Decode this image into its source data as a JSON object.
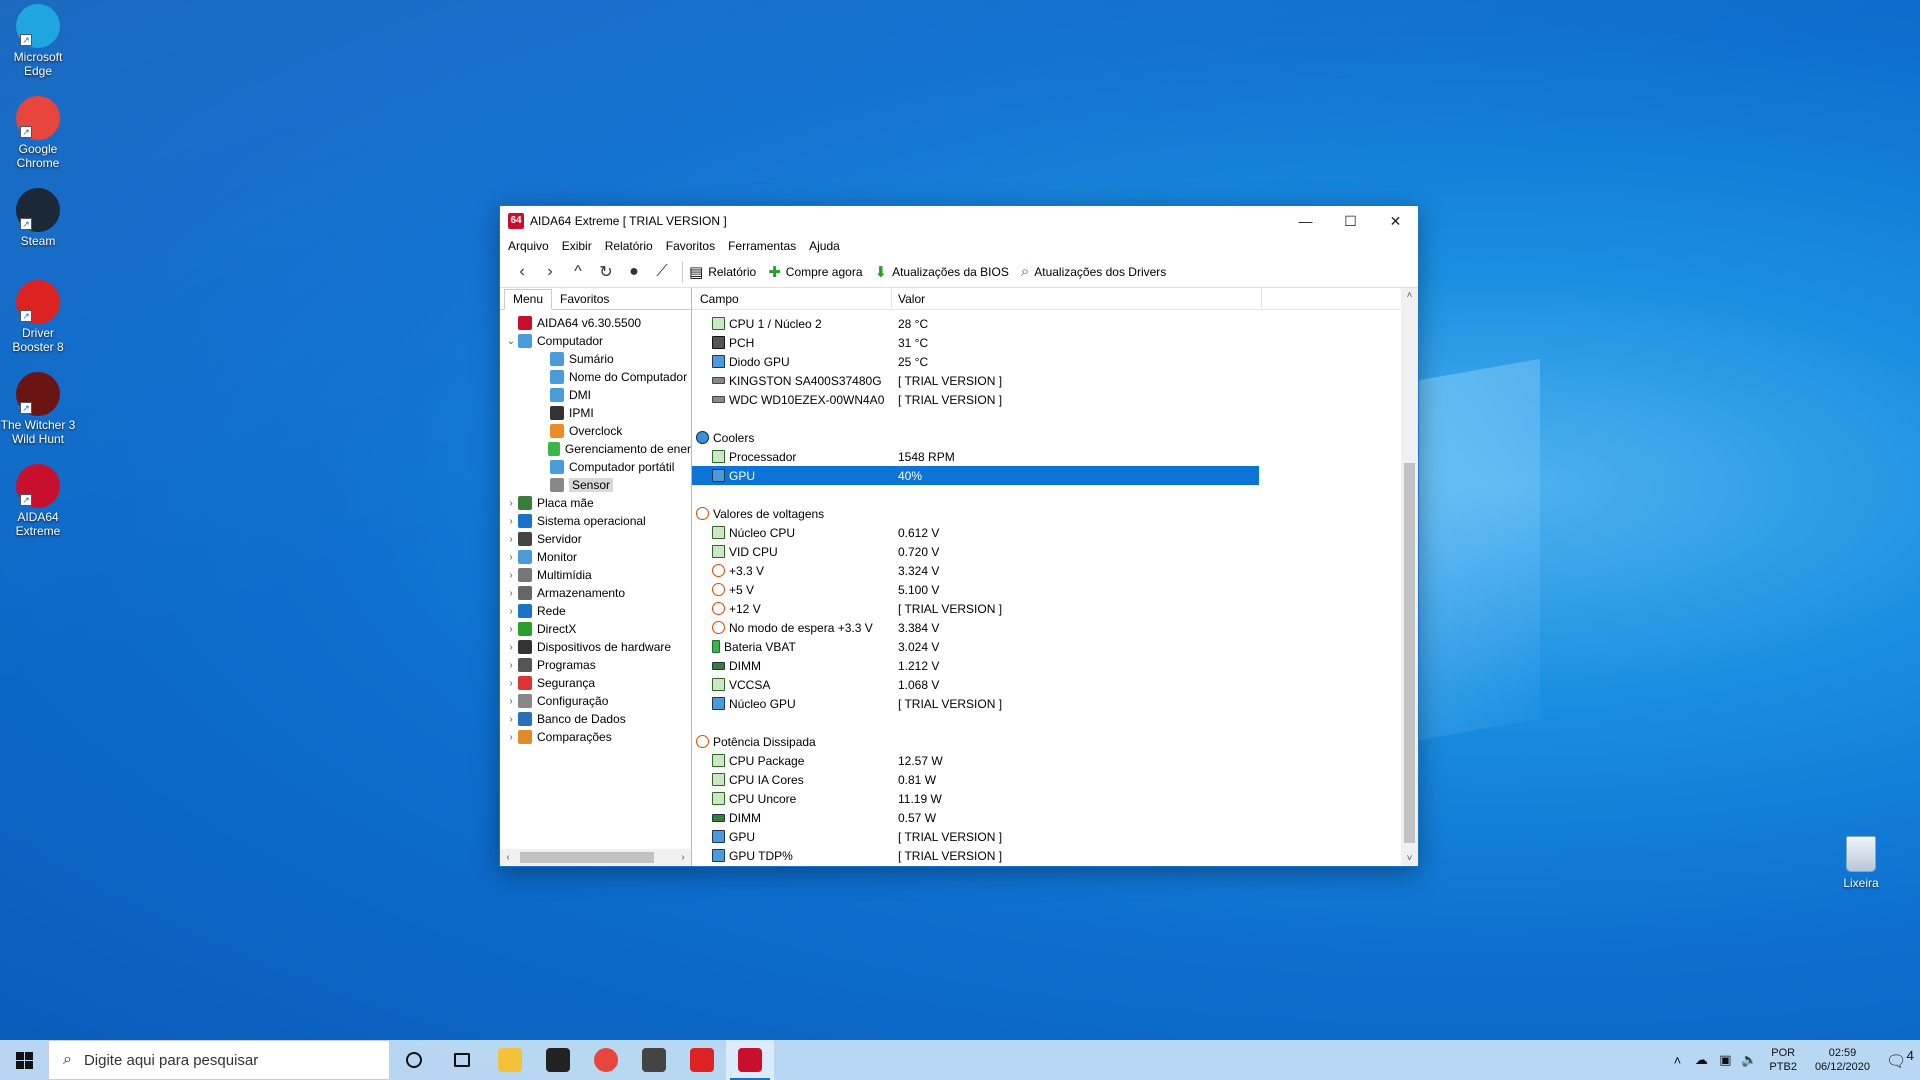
{
  "desktop": {
    "icons": [
      {
        "label": "Microsoft Edge",
        "icon": "edge-icon",
        "color": "#1fa5e0"
      },
      {
        "label": "Google Chrome",
        "icon": "chrome-icon",
        "color": "#e8453c"
      },
      {
        "label": "Steam",
        "icon": "steam-icon",
        "color": "#1b2838"
      },
      {
        "label": "Driver Booster 8",
        "icon": "driver-booster-icon",
        "color": "#d22"
      },
      {
        "label": "The Witcher 3 Wild Hunt",
        "icon": "witcher-icon",
        "color": "#6a1414"
      },
      {
        "label": "AIDA64 Extreme",
        "icon": "aida64-icon",
        "color": "#c8102e"
      }
    ],
    "recycle_bin": "Lixeira"
  },
  "window": {
    "title": "AIDA64 Extreme  [ TRIAL VERSION ]",
    "app_badge": "64",
    "controls": {
      "minimize": "—",
      "maximize": "☐",
      "close": "✕"
    },
    "menu": [
      "Arquivo",
      "Exibir",
      "Relatório",
      "Favoritos",
      "Ferramentas",
      "Ajuda"
    ],
    "toolbar": {
      "nav_icons": [
        "back-icon",
        "forward-icon",
        "up-icon",
        "refresh-icon",
        "user-icon",
        "chart-icon"
      ],
      "buttons": [
        {
          "label": "Relatório",
          "icon": "report-icon"
        },
        {
          "label": "Compre agora",
          "icon": "buy-icon"
        },
        {
          "label": "Atualizações da BIOS",
          "icon": "download-icon"
        },
        {
          "label": "Atualizações dos Drivers",
          "icon": "search-icon"
        }
      ]
    },
    "left": {
      "tabs": [
        "Menu",
        "Favoritos"
      ],
      "active_tab": "Menu",
      "tree": [
        {
          "label": "AIDA64 v6.30.5500",
          "level": 0,
          "arrow": "",
          "icon": "aida64-icon"
        },
        {
          "label": "Computador",
          "level": 0,
          "arrow": "⌄",
          "icon": "computer-icon"
        },
        {
          "label": "Sumário",
          "level": 1,
          "arrow": "",
          "icon": "computer-icon"
        },
        {
          "label": "Nome do Computador",
          "level": 1,
          "arrow": "",
          "icon": "computer-icon"
        },
        {
          "label": "DMI",
          "level": 1,
          "arrow": "",
          "icon": "computer-icon"
        },
        {
          "label": "IPMI",
          "level": 1,
          "arrow": "",
          "icon": "ipmi-icon"
        },
        {
          "label": "Overclock",
          "level": 1,
          "arrow": "",
          "icon": "flame-icon"
        },
        {
          "label": "Gerenciamento de ener",
          "level": 1,
          "arrow": "",
          "icon": "battery-icon"
        },
        {
          "label": "Computador portátil",
          "level": 1,
          "arrow": "",
          "icon": "laptop-icon"
        },
        {
          "label": "Sensor",
          "level": 1,
          "arrow": "",
          "icon": "sensor-icon",
          "selected": true
        },
        {
          "label": "Placa mãe",
          "level": 0,
          "arrow": "›",
          "icon": "motherboard-icon"
        },
        {
          "label": "Sistema operacional",
          "level": 0,
          "arrow": "›",
          "icon": "windows-icon"
        },
        {
          "label": "Servidor",
          "level": 0,
          "arrow": "›",
          "icon": "server-icon"
        },
        {
          "label": "Monitor",
          "level": 0,
          "arrow": "›",
          "icon": "monitor-icon"
        },
        {
          "label": "Multimídia",
          "level": 0,
          "arrow": "›",
          "icon": "speaker-icon"
        },
        {
          "label": "Armazenamento",
          "level": 0,
          "arrow": "›",
          "icon": "storage-icon"
        },
        {
          "label": "Rede",
          "level": 0,
          "arrow": "›",
          "icon": "network-icon"
        },
        {
          "label": "DirectX",
          "level": 0,
          "arrow": "›",
          "icon": "xbox-icon"
        },
        {
          "label": "Dispositivos de hardware",
          "level": 0,
          "arrow": "›",
          "icon": "device-icon"
        },
        {
          "label": "Programas",
          "level": 0,
          "arrow": "›",
          "icon": "programs-icon"
        },
        {
          "label": "Segurança",
          "level": 0,
          "arrow": "›",
          "icon": "shield-icon"
        },
        {
          "label": "Configuração",
          "level": 0,
          "arrow": "›",
          "icon": "config-icon"
        },
        {
          "label": "Banco de Dados",
          "level": 0,
          "arrow": "›",
          "icon": "database-icon"
        },
        {
          "label": "Comparações",
          "level": 0,
          "arrow": "›",
          "icon": "benchmark-icon"
        }
      ]
    },
    "right": {
      "columns": [
        "Campo",
        "Valor"
      ],
      "rows": [
        {
          "field": "CPU 1 / Núcleo 2",
          "value": "28 °C",
          "icon": "chip"
        },
        {
          "field": "PCH",
          "value": "31 °C",
          "icon": "pch"
        },
        {
          "field": "Diodo GPU",
          "value": "25 °C",
          "icon": "mon"
        },
        {
          "field": "KINGSTON SA400S37480G",
          "value": "[ TRIAL VERSION ]",
          "icon": "disk"
        },
        {
          "field": "WDC WD10EZEX-00WN4A0",
          "value": "[ TRIAL VERSION ]",
          "icon": "disk"
        },
        {
          "field": "",
          "value": "",
          "icon": ""
        },
        {
          "field": "Coolers",
          "value": "",
          "icon": "fan",
          "group": true
        },
        {
          "field": "Processador",
          "value": "1548 RPM",
          "icon": "chip"
        },
        {
          "field": "GPU",
          "value": "40%",
          "icon": "mon",
          "selected": true
        },
        {
          "field": "",
          "value": "",
          "icon": ""
        },
        {
          "field": "Valores de voltagens",
          "value": "",
          "icon": "volt",
          "group": true
        },
        {
          "field": "Núcleo CPU",
          "value": "0.612 V",
          "icon": "chip"
        },
        {
          "field": "VID CPU",
          "value": "0.720 V",
          "icon": "chip"
        },
        {
          "field": "+3.3 V",
          "value": "3.324 V",
          "icon": "volt"
        },
        {
          "field": "+5 V",
          "value": "5.100 V",
          "icon": "volt"
        },
        {
          "field": "+12 V",
          "value": "[ TRIAL VERSION ]",
          "icon": "volt"
        },
        {
          "field": "No modo de espera +3.3 V",
          "value": "3.384 V",
          "icon": "volt"
        },
        {
          "field": "Bateria VBAT",
          "value": "3.024 V",
          "icon": "bat"
        },
        {
          "field": "DIMM",
          "value": "1.212 V",
          "icon": "ram"
        },
        {
          "field": "VCCSA",
          "value": "1.068 V",
          "icon": "chip"
        },
        {
          "field": "Núcleo GPU",
          "value": "[ TRIAL VERSION ]",
          "icon": "mon"
        },
        {
          "field": "",
          "value": "",
          "icon": ""
        },
        {
          "field": "Potência Dissipada",
          "value": "",
          "icon": "volt",
          "group": true
        },
        {
          "field": "CPU Package",
          "value": "12.57 W",
          "icon": "chip"
        },
        {
          "field": "CPU IA Cores",
          "value": "0.81 W",
          "icon": "chip"
        },
        {
          "field": "CPU Uncore",
          "value": "11.19 W",
          "icon": "chip"
        },
        {
          "field": "DIMM",
          "value": "0.57 W",
          "icon": "ram"
        },
        {
          "field": "GPU",
          "value": "[ TRIAL VERSION ]",
          "icon": "mon"
        },
        {
          "field": "GPU TDP%",
          "value": "[ TRIAL VERSION ]",
          "icon": "mon"
        }
      ]
    }
  },
  "taskbar": {
    "search_placeholder": "Digite aqui para pesquisar",
    "apps": [
      {
        "name": "cortana-icon",
        "color": "#ffffff"
      },
      {
        "name": "task-view-icon",
        "color": "#ffffff"
      },
      {
        "name": "file-explorer-icon",
        "color": "#f3c13a"
      },
      {
        "name": "store-icon",
        "color": "#222222"
      },
      {
        "name": "chrome-icon",
        "color": "#e8453c"
      },
      {
        "name": "mail-icon",
        "color": "#444444"
      },
      {
        "name": "driver-booster-icon",
        "color": "#d22"
      },
      {
        "name": "aida64-icon",
        "color": "#c8102e"
      }
    ],
    "lang_top": "POR",
    "lang_bottom": "PTB2",
    "time": "02:59",
    "date": "06/12/2020",
    "notification_count": "4"
  }
}
